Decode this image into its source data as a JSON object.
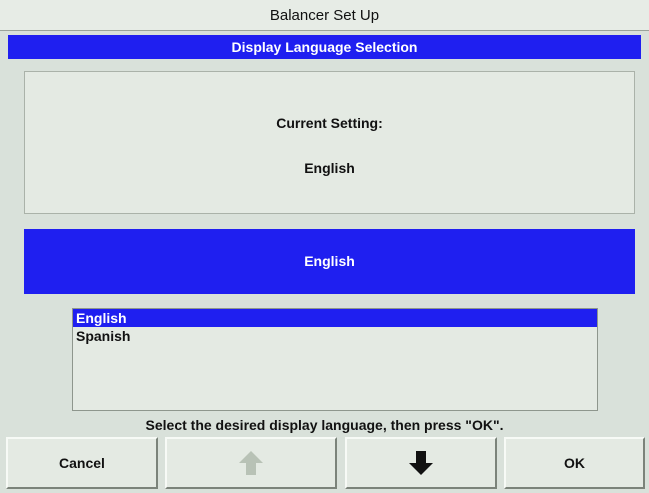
{
  "window": {
    "title": "Balancer Set Up"
  },
  "header": {
    "subtitle": "Display Language Selection"
  },
  "current": {
    "label": "Current Setting:",
    "value": "English"
  },
  "selected": {
    "value": "English"
  },
  "language_list": {
    "items": [
      {
        "label": "English",
        "selected": true
      },
      {
        "label": "Spanish",
        "selected": false
      }
    ]
  },
  "instruction": "Select the desired display language, then press \"OK\".",
  "buttons": {
    "cancel": "Cancel",
    "up_icon": "arrow-up-icon",
    "up_enabled": false,
    "down_icon": "arrow-down-icon",
    "down_enabled": true,
    "ok": "OK"
  },
  "colors": {
    "highlight": "#1f1ff0",
    "panel": "#e4eae3",
    "background": "#d9e1da",
    "disabled_arrow": "#b8c2b6"
  }
}
